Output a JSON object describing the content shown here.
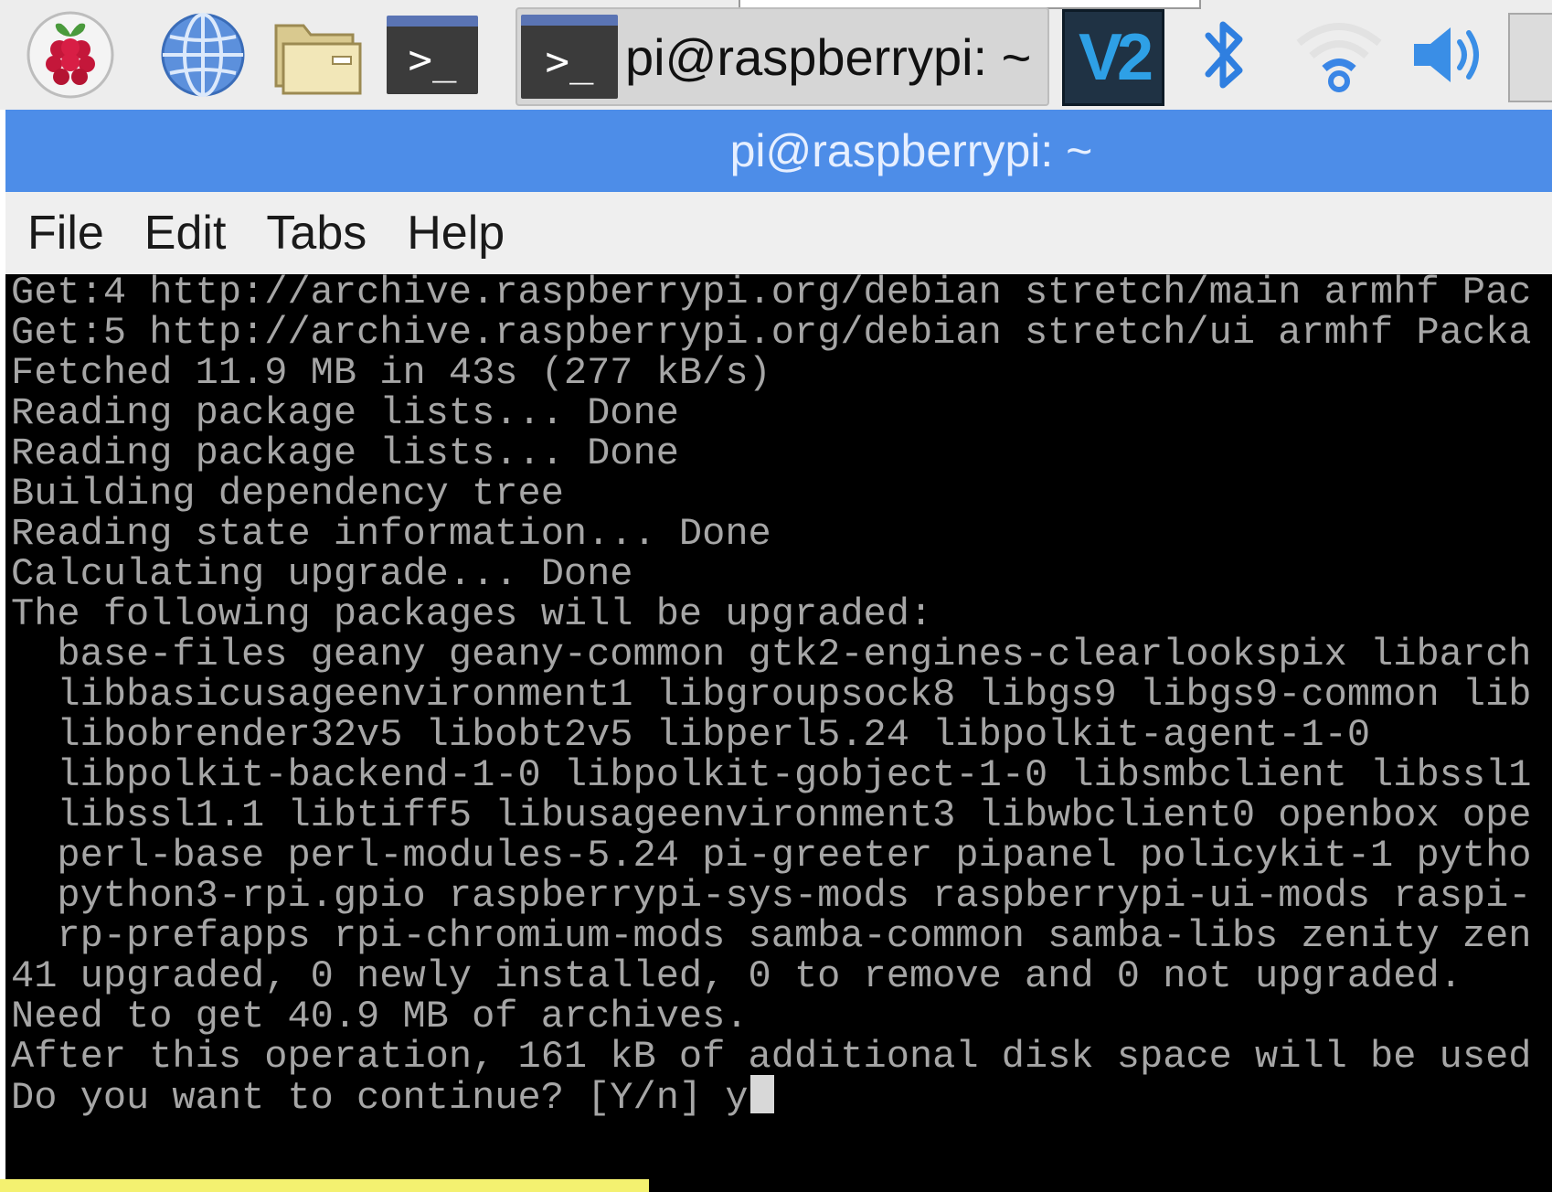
{
  "taskbar": {
    "icons": {
      "menu": "raspberry-icon",
      "browser": "globe-icon",
      "files": "folder-icon",
      "terminal": "terminal-icon",
      "vnc": "vnc-icon",
      "bluetooth": "bluetooth-icon",
      "wifi": "wifi-icon",
      "volume": "volume-icon"
    },
    "terminal_glyph": ">_",
    "vnc_label": "V2",
    "task_item_label": "pi@raspberrypi: ~"
  },
  "window": {
    "title": "pi@raspberrypi: ~"
  },
  "menu": {
    "file": "File",
    "edit": "Edit",
    "tabs": "Tabs",
    "help": "Help"
  },
  "terminal": {
    "lines": [
      "Get:4 http://archive.raspberrypi.org/debian stretch/main armhf Pac",
      "Get:5 http://archive.raspberrypi.org/debian stretch/ui armhf Packa",
      "Fetched 11.9 MB in 43s (277 kB/s)",
      "Reading package lists... Done",
      "Reading package lists... Done",
      "Building dependency tree",
      "Reading state information... Done",
      "Calculating upgrade... Done",
      "The following packages will be upgraded:",
      "  base-files geany geany-common gtk2-engines-clearlookspix libarch",
      "  libbasicusageenvironment1 libgroupsock8 libgs9 libgs9-common lib",
      "  libobrender32v5 libobt2v5 libperl5.24 libpolkit-agent-1-0",
      "  libpolkit-backend-1-0 libpolkit-gobject-1-0 libsmbclient libssl1",
      "  libssl1.1 libtiff5 libusageenvironment3 libwbclient0 openbox ope",
      "  perl-base perl-modules-5.24 pi-greeter pipanel policykit-1 pytho",
      "  python3-rpi.gpio raspberrypi-sys-mods raspberrypi-ui-mods raspi-",
      "  rp-prefapps rpi-chromium-mods samba-common samba-libs zenity zen",
      "41 upgraded, 0 newly installed, 0 to remove and 0 not upgraded.",
      "Need to get 40.9 MB of archives.",
      "After this operation, 161 kB of additional disk space will be used",
      "Do you want to continue? [Y/n] y"
    ]
  },
  "colors": {
    "titlebar": "#4d8de8",
    "terminal_bg": "#000000",
    "terminal_fg": "#a6a6a6",
    "highlight": "#f4f170"
  }
}
